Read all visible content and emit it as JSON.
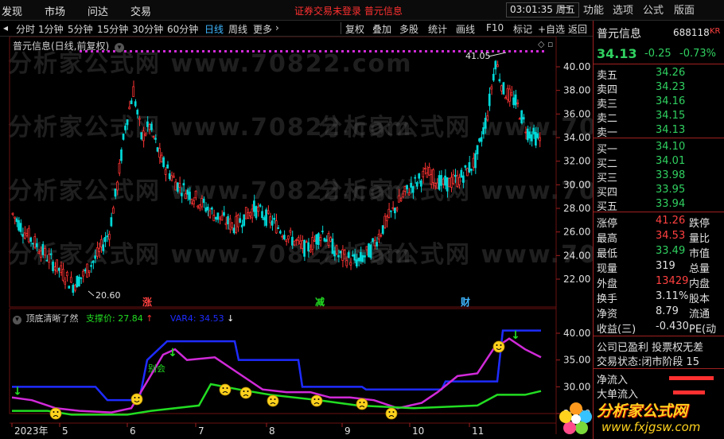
{
  "menu": [
    "发现",
    "市场",
    "问达",
    "交易"
  ],
  "status_text": "证券交易未登录   普元信息",
  "clock": "03:01:35 周五",
  "window_buttons": [
    "功能",
    "选项",
    "公式",
    "版面"
  ],
  "toolbar": {
    "periods": [
      "分时",
      "1分钟",
      "5分钟",
      "15分钟",
      "30分钟",
      "60分钟",
      "日线",
      "周线",
      "更多"
    ],
    "active_period": "日线",
    "actions": [
      "复权",
      "叠加",
      "多股",
      "统计",
      "画线",
      "F10",
      "标记",
      "+自选",
      "返回"
    ]
  },
  "chart": {
    "title": "普元信息(日线,前复权)",
    "y_ticks": [
      "40.00",
      "38.00",
      "36.00",
      "34.00",
      "32.00",
      "30.00",
      "28.00",
      "26.00",
      "24.00",
      "22.00"
    ],
    "high_label": "41.05",
    "low_label": "20.60",
    "markers": [
      "涨",
      "减",
      "财"
    ]
  },
  "indicator": {
    "name": "顶底清晰了然",
    "support_label": "支撑价: 27.84",
    "var_label": "VAR4: 34.53",
    "y_ticks": [
      "40.00",
      "35.00",
      "30.00",
      "25.00"
    ],
    "annotation": "别会"
  },
  "x_axis": [
    "2023年",
    "5",
    "6",
    "7",
    "8",
    "9",
    "10",
    "11"
  ],
  "quote": {
    "name": "普元信息",
    "code": "688118",
    "badge": "KR",
    "price": "34.13",
    "change": "-0.25",
    "change_pct": "-0.73%",
    "asks": [
      {
        "label": "卖五",
        "price": "34.26"
      },
      {
        "label": "卖四",
        "price": "34.23"
      },
      {
        "label": "卖三",
        "price": "34.16"
      },
      {
        "label": "卖二",
        "price": "34.15"
      },
      {
        "label": "卖一",
        "price": "34.13"
      }
    ],
    "bids": [
      {
        "label": "买一",
        "price": "34.10"
      },
      {
        "label": "买二",
        "price": "34.01"
      },
      {
        "label": "买三",
        "price": "33.98"
      },
      {
        "label": "买四",
        "price": "33.95"
      },
      {
        "label": "买五",
        "price": "33.94"
      }
    ],
    "stats": [
      {
        "label": "涨停",
        "value": "41.26",
        "label2": "跌停",
        "color": "#ff4040"
      },
      {
        "label": "最高",
        "value": "34.53",
        "label2": "量比",
        "color": "#ff4040"
      },
      {
        "label": "最低",
        "value": "33.49",
        "label2": "市值",
        "color": "#30d060"
      },
      {
        "label": "现量",
        "value": "319",
        "label2": "总量",
        "color": "#e0e0e0"
      },
      {
        "label": "外盘",
        "value": "13429",
        "label2": "内盘",
        "color": "#ff4040"
      },
      {
        "label": "换手",
        "value": "3.11%",
        "label2": "股本",
        "color": "#e0e0e0"
      },
      {
        "label": "净资",
        "value": "8.79",
        "label2": "流通",
        "color": "#e0e0e0"
      },
      {
        "label": "收益(三)",
        "value": "-0.430",
        "label2": "PE(动",
        "color": "#e0e0e0"
      }
    ],
    "notes": [
      "公司已盈利 投票权无差",
      "交易状态:闭市阶段 15"
    ],
    "flows": [
      "净流入",
      "大单流入"
    ]
  },
  "watermark": "分析家公式网 www.70822.com",
  "logo": {
    "title": "分析家公式网",
    "url": "www.fxjgsw.com"
  },
  "colors": {
    "up": "#ff3333",
    "down": "#00d8d8",
    "blue_line": "#1e2cff",
    "purple_line": "#d02ad8",
    "green_line": "#22dd22",
    "accent": "#3fb6ff"
  }
}
